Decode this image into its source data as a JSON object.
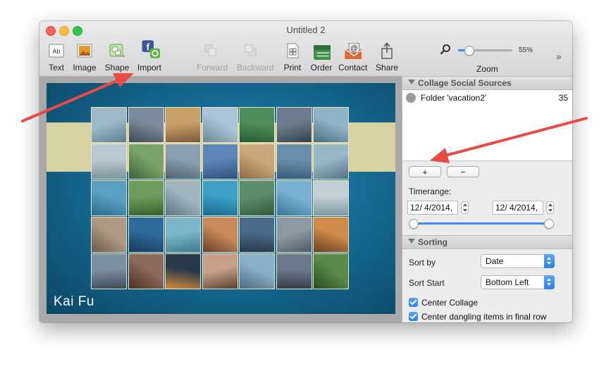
{
  "window": {
    "title": "Untitled 2"
  },
  "toolbar": {
    "text": "Text",
    "image": "Image",
    "shape": "Shape",
    "import": "Import",
    "forward": "Forward",
    "backward": "Backward",
    "print": "Print",
    "order": "Order",
    "contact": "Contact",
    "share": "Share",
    "zoom_label": "Zoom",
    "zoom_value": "55%",
    "zoom_fraction": 0.2,
    "overflow": "»"
  },
  "canvas": {
    "caption": "Kai Fu"
  },
  "sources": {
    "header": "Collage Social Sources",
    "items": [
      {
        "label": "Folder 'vacation2'",
        "count": "35"
      }
    ],
    "add": "+",
    "remove": "−"
  },
  "timerange": {
    "label": "Timerange:",
    "start": "12/  4/2014,",
    "end": "12/  4/2014,"
  },
  "sorting": {
    "header": "Sorting",
    "sort_by_label": "Sort by",
    "sort_by_value": "Date",
    "sort_start_label": "Sort Start",
    "sort_start_value": "Bottom Left",
    "center_collage": "Center Collage",
    "center_dangling": "Center dangling items in final row"
  },
  "colors": {
    "accent": "#3d8ee6",
    "arrow": "#e84a45"
  }
}
